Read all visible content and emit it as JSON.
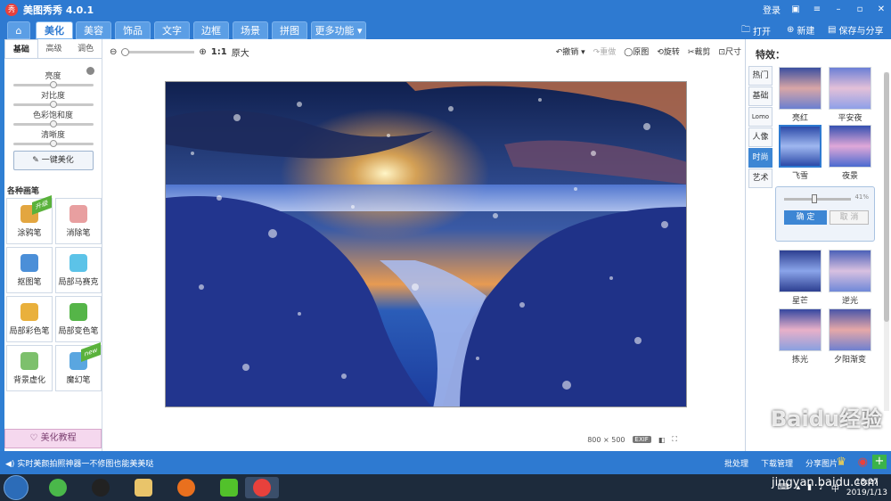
{
  "titlebar": {
    "app_title": "美图秀秀 4.0.1",
    "login": "登录",
    "logo_char": "秀"
  },
  "nav": {
    "tabs": [
      "美化",
      "美容",
      "饰品",
      "文字",
      "边框",
      "场景",
      "拼图",
      "更多功能"
    ],
    "open": "打开",
    "new": "新建",
    "save_share": "保存与分享"
  },
  "left": {
    "subtabs": [
      "基础",
      "高级",
      "调色"
    ],
    "sliders": [
      {
        "label": "亮度",
        "value": 0.5
      },
      {
        "label": "对比度",
        "value": 0.5
      },
      {
        "label": "色彩饱和度",
        "value": 0.5
      },
      {
        "label": "清晰度",
        "value": 0.5
      }
    ],
    "one_key": "一键美化",
    "brushes_title": "各种画笔",
    "brushes": [
      {
        "label": "涂鸦笔",
        "badge": "升级"
      },
      {
        "label": "消除笔",
        "badge": ""
      },
      {
        "label": "抠图笔",
        "badge": ""
      },
      {
        "label": "局部马赛克",
        "badge": ""
      },
      {
        "label": "局部彩色笔",
        "badge": ""
      },
      {
        "label": "局部变色笔",
        "badge": ""
      },
      {
        "label": "背景虚化",
        "badge": ""
      },
      {
        "label": "魔幻笔",
        "badge": "new"
      }
    ],
    "tutorial": "美化教程"
  },
  "center": {
    "zoom_ratio": "1:1",
    "zoom_original": "原大",
    "tools": {
      "undo": "撤销",
      "redo": "重做",
      "original": "原图",
      "rotate": "旋转",
      "crop": "裁剪",
      "size": "尺寸"
    },
    "image_size": "800 × 500",
    "exif": "EXIF"
  },
  "right": {
    "title": "特效：",
    "categories": [
      "热门",
      "基础",
      "Lomo",
      "人像",
      "时尚",
      "艺术"
    ],
    "active_category": "时尚",
    "effects": [
      "亮红",
      "平安夜",
      "飞雪",
      "夜景",
      "星芒",
      "逆光",
      "拣光",
      "夕阳渐变"
    ],
    "selected_effect": "飞雪",
    "popup": {
      "percent": "41%",
      "confirm": "确 定",
      "cancel": "取 消",
      "level": 0.41
    }
  },
  "status": {
    "message": "实时美颜拍照神器一不修图也能美美哒",
    "batch": "批处理",
    "download_manager": "下载管理",
    "share_image": "分享图片"
  },
  "taskbar": {
    "time": "18:27",
    "date": "2019/1/13"
  },
  "watermark": {
    "text": "Baidu经验",
    "url": "jingyan.baidu.com"
  },
  "colors": {
    "accent": "#2e7ad1",
    "status_bar": "#2e7ad1",
    "taskbar": "#1d2b3c"
  }
}
